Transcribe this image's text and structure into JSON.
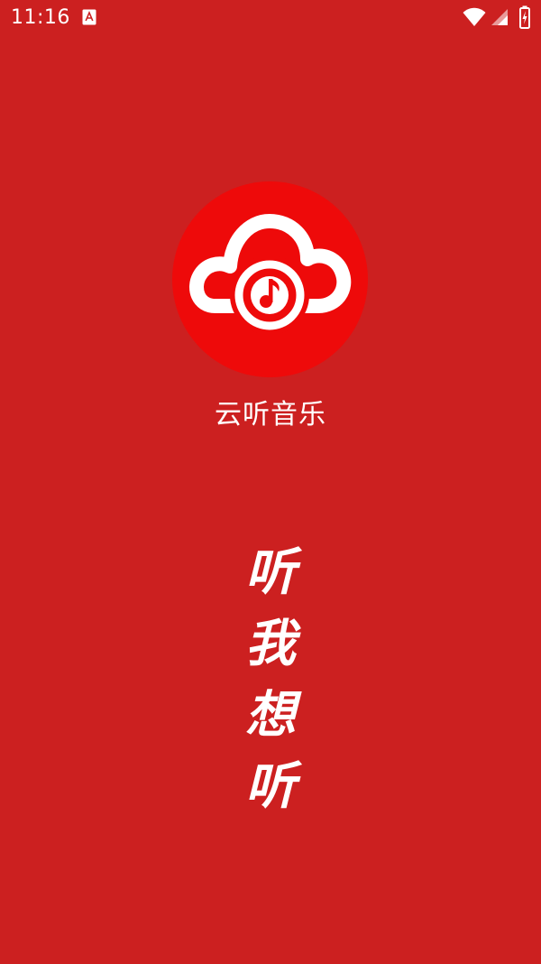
{
  "status_bar": {
    "time": "11:16",
    "notification_icon": "a-badge-icon",
    "wifi_icon": "wifi-icon",
    "signal_icon": "cellular-signal-icon",
    "battery_icon": "battery-charging-icon"
  },
  "splash": {
    "logo_icon": "cloud-music-note-icon",
    "app_name": "云听音乐",
    "slogan_chars": [
      "听",
      "我",
      "想",
      "听"
    ]
  },
  "colors": {
    "background": "#cc2020",
    "logo_circle": "#ee0a0a",
    "foreground": "#ffffff"
  }
}
